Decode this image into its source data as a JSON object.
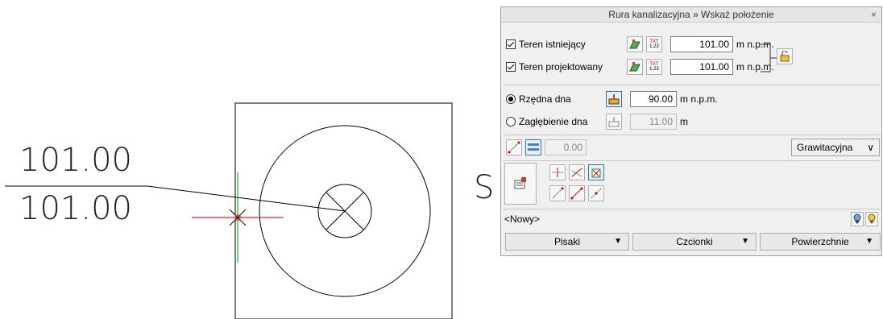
{
  "drawing": {
    "elevation_top": "101.00",
    "elevation_bottom": "101.00",
    "side_mark": "S"
  },
  "dialog": {
    "title": "Rura kanalizacyjna » Wskaż położenie",
    "close_glyph": "×",
    "terrain_existing": {
      "label": "Teren istniejący",
      "checked": true,
      "value": "101.00",
      "unit": "m n.p.m."
    },
    "terrain_designed": {
      "label": "Teren projektowany",
      "checked": true,
      "value": "101.00",
      "unit": "m n.p.m."
    },
    "bottom_ordinate": {
      "label": "Rzędna dna",
      "selected": true,
      "value": "90.00",
      "unit": "m n.p.m."
    },
    "bottom_depth": {
      "label": "Zagłębienie dna",
      "selected": false,
      "value": "11.00",
      "unit": "m"
    },
    "slope_value": "0.00",
    "flow_type": "Grawitacyjna",
    "dropdown_glyph": "∨",
    "name_value": "<Nowy>",
    "txt_icon_text": "TXT",
    "txt_icon_num": "1.23",
    "buttons": {
      "pens": "Pisaki",
      "fonts": "Czcionki",
      "surfaces": "Powierzchnie"
    },
    "button_arrow": "▼"
  }
}
